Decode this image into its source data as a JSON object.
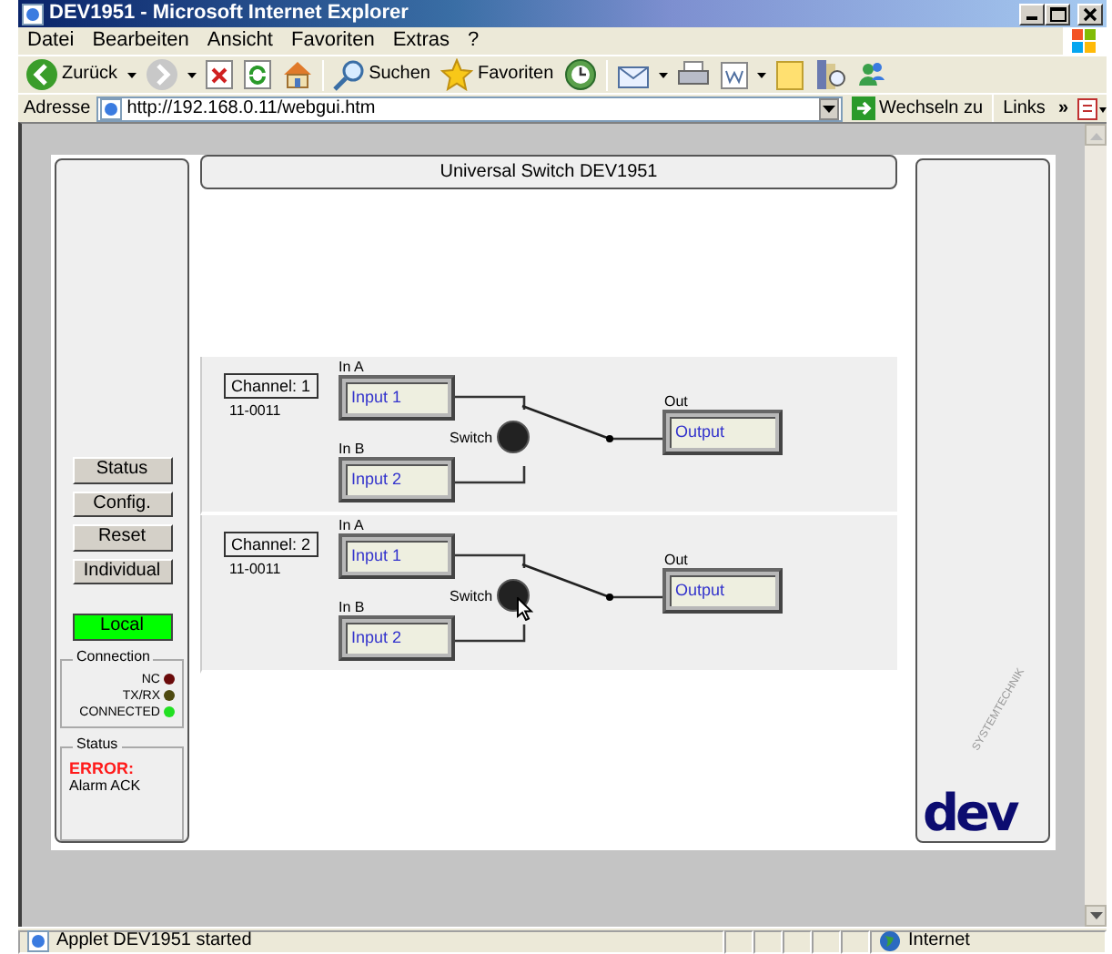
{
  "window": {
    "title": "DEV1951 - Microsoft Internet Explorer"
  },
  "menu": [
    "Datei",
    "Bearbeiten",
    "Ansicht",
    "Favoriten",
    "Extras",
    "?"
  ],
  "toolbar": [
    {
      "kind": "back",
      "label": "Zurück",
      "dropdown": true
    },
    {
      "kind": "forward",
      "dropdown": true
    },
    {
      "kind": "stop"
    },
    {
      "kind": "refresh"
    },
    {
      "kind": "home"
    },
    {
      "kind": "search",
      "label": "Suchen"
    },
    {
      "kind": "favorites",
      "label": "Favoriten"
    },
    {
      "kind": "history"
    },
    {
      "kind": "mail",
      "dropdown": true
    },
    {
      "kind": "print"
    },
    {
      "kind": "edit",
      "dropdown": true
    },
    {
      "kind": "note"
    },
    {
      "kind": "research"
    },
    {
      "kind": "messenger"
    }
  ],
  "address": {
    "label": "Adresse",
    "url": "http://192.168.0.11/webgui.htm",
    "go": "Wechseln zu",
    "links": "Links",
    "more": "»"
  },
  "applet": {
    "title": "Universal Switch  DEV1951",
    "buttons": [
      "Status",
      "Config.",
      "Reset",
      "Individual"
    ],
    "mode": {
      "label": "Local",
      "active": true
    },
    "connection": {
      "title": "Connection",
      "indicators": [
        {
          "label": "NC",
          "color": "#6a0a0a"
        },
        {
          "label": "TX/RX",
          "color": "#4e4a10"
        },
        {
          "label": "CONNECTED",
          "color": "#22e022"
        }
      ]
    },
    "status": {
      "title": "Status",
      "error": "ERROR:",
      "message": "Alarm ACK"
    },
    "channels": [
      {
        "name": "Channel: 1",
        "code": "11-0011",
        "in_a": {
          "label": "In A",
          "value": "Input 1",
          "selected": true
        },
        "in_b": {
          "label": "In B",
          "value": "Input 2",
          "selected": false
        },
        "switch_label": "Switch",
        "out": {
          "label": "Out",
          "value": "Output"
        }
      },
      {
        "name": "Channel: 2",
        "code": "11-0011",
        "in_a": {
          "label": "In A",
          "value": "Input 1",
          "selected": true
        },
        "in_b": {
          "label": "In B",
          "value": "Input 2",
          "selected": false
        },
        "switch_label": "Switch",
        "out": {
          "label": "Out",
          "value": "Output"
        }
      }
    ],
    "logo": {
      "name": "dev",
      "tagline": "SYSTEMTECHNIK"
    }
  },
  "status_bar": {
    "text": "Applet DEV1951 started",
    "zone": "Internet"
  }
}
